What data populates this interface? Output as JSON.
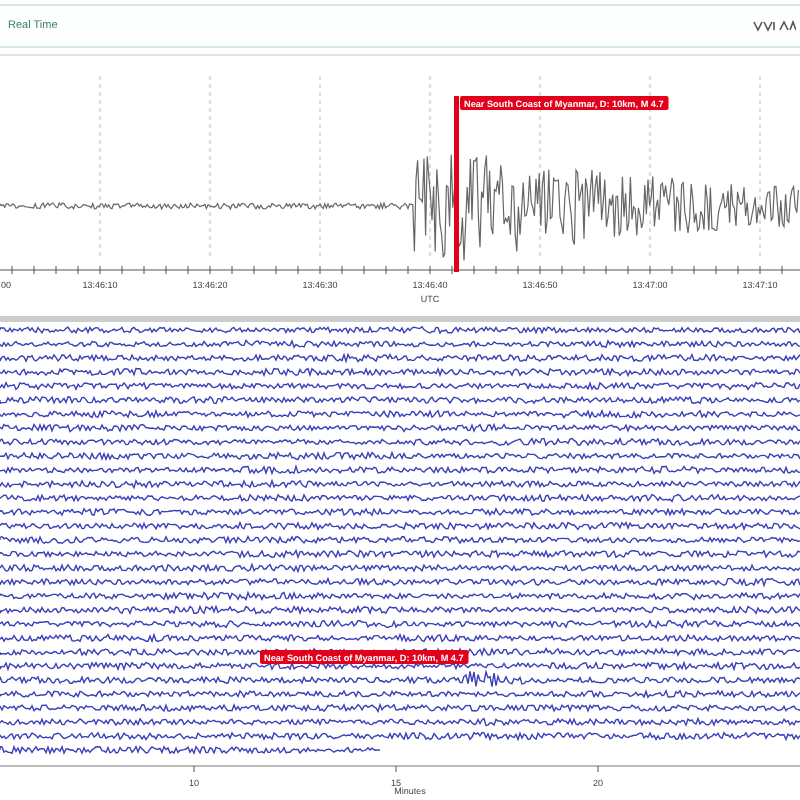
{
  "header": {
    "title": "Real Time"
  },
  "waveform_panel": {
    "event_label": "Near South Coast of Myanmar, D: 10km, M 4.7",
    "time_ticks": [
      "00",
      "13:46:10",
      "13:46:20",
      "13:46:30",
      "13:46:40",
      "13:46:50",
      "13:47:00",
      "13:47:10"
    ],
    "axis_label": "UTC"
  },
  "helicorder": {
    "event_label": "Near South Coast of Myanmar, D: 10km, M 4.7",
    "minute_ticks": [
      "10",
      "15",
      "20"
    ],
    "axis_label": "Minutes"
  }
}
